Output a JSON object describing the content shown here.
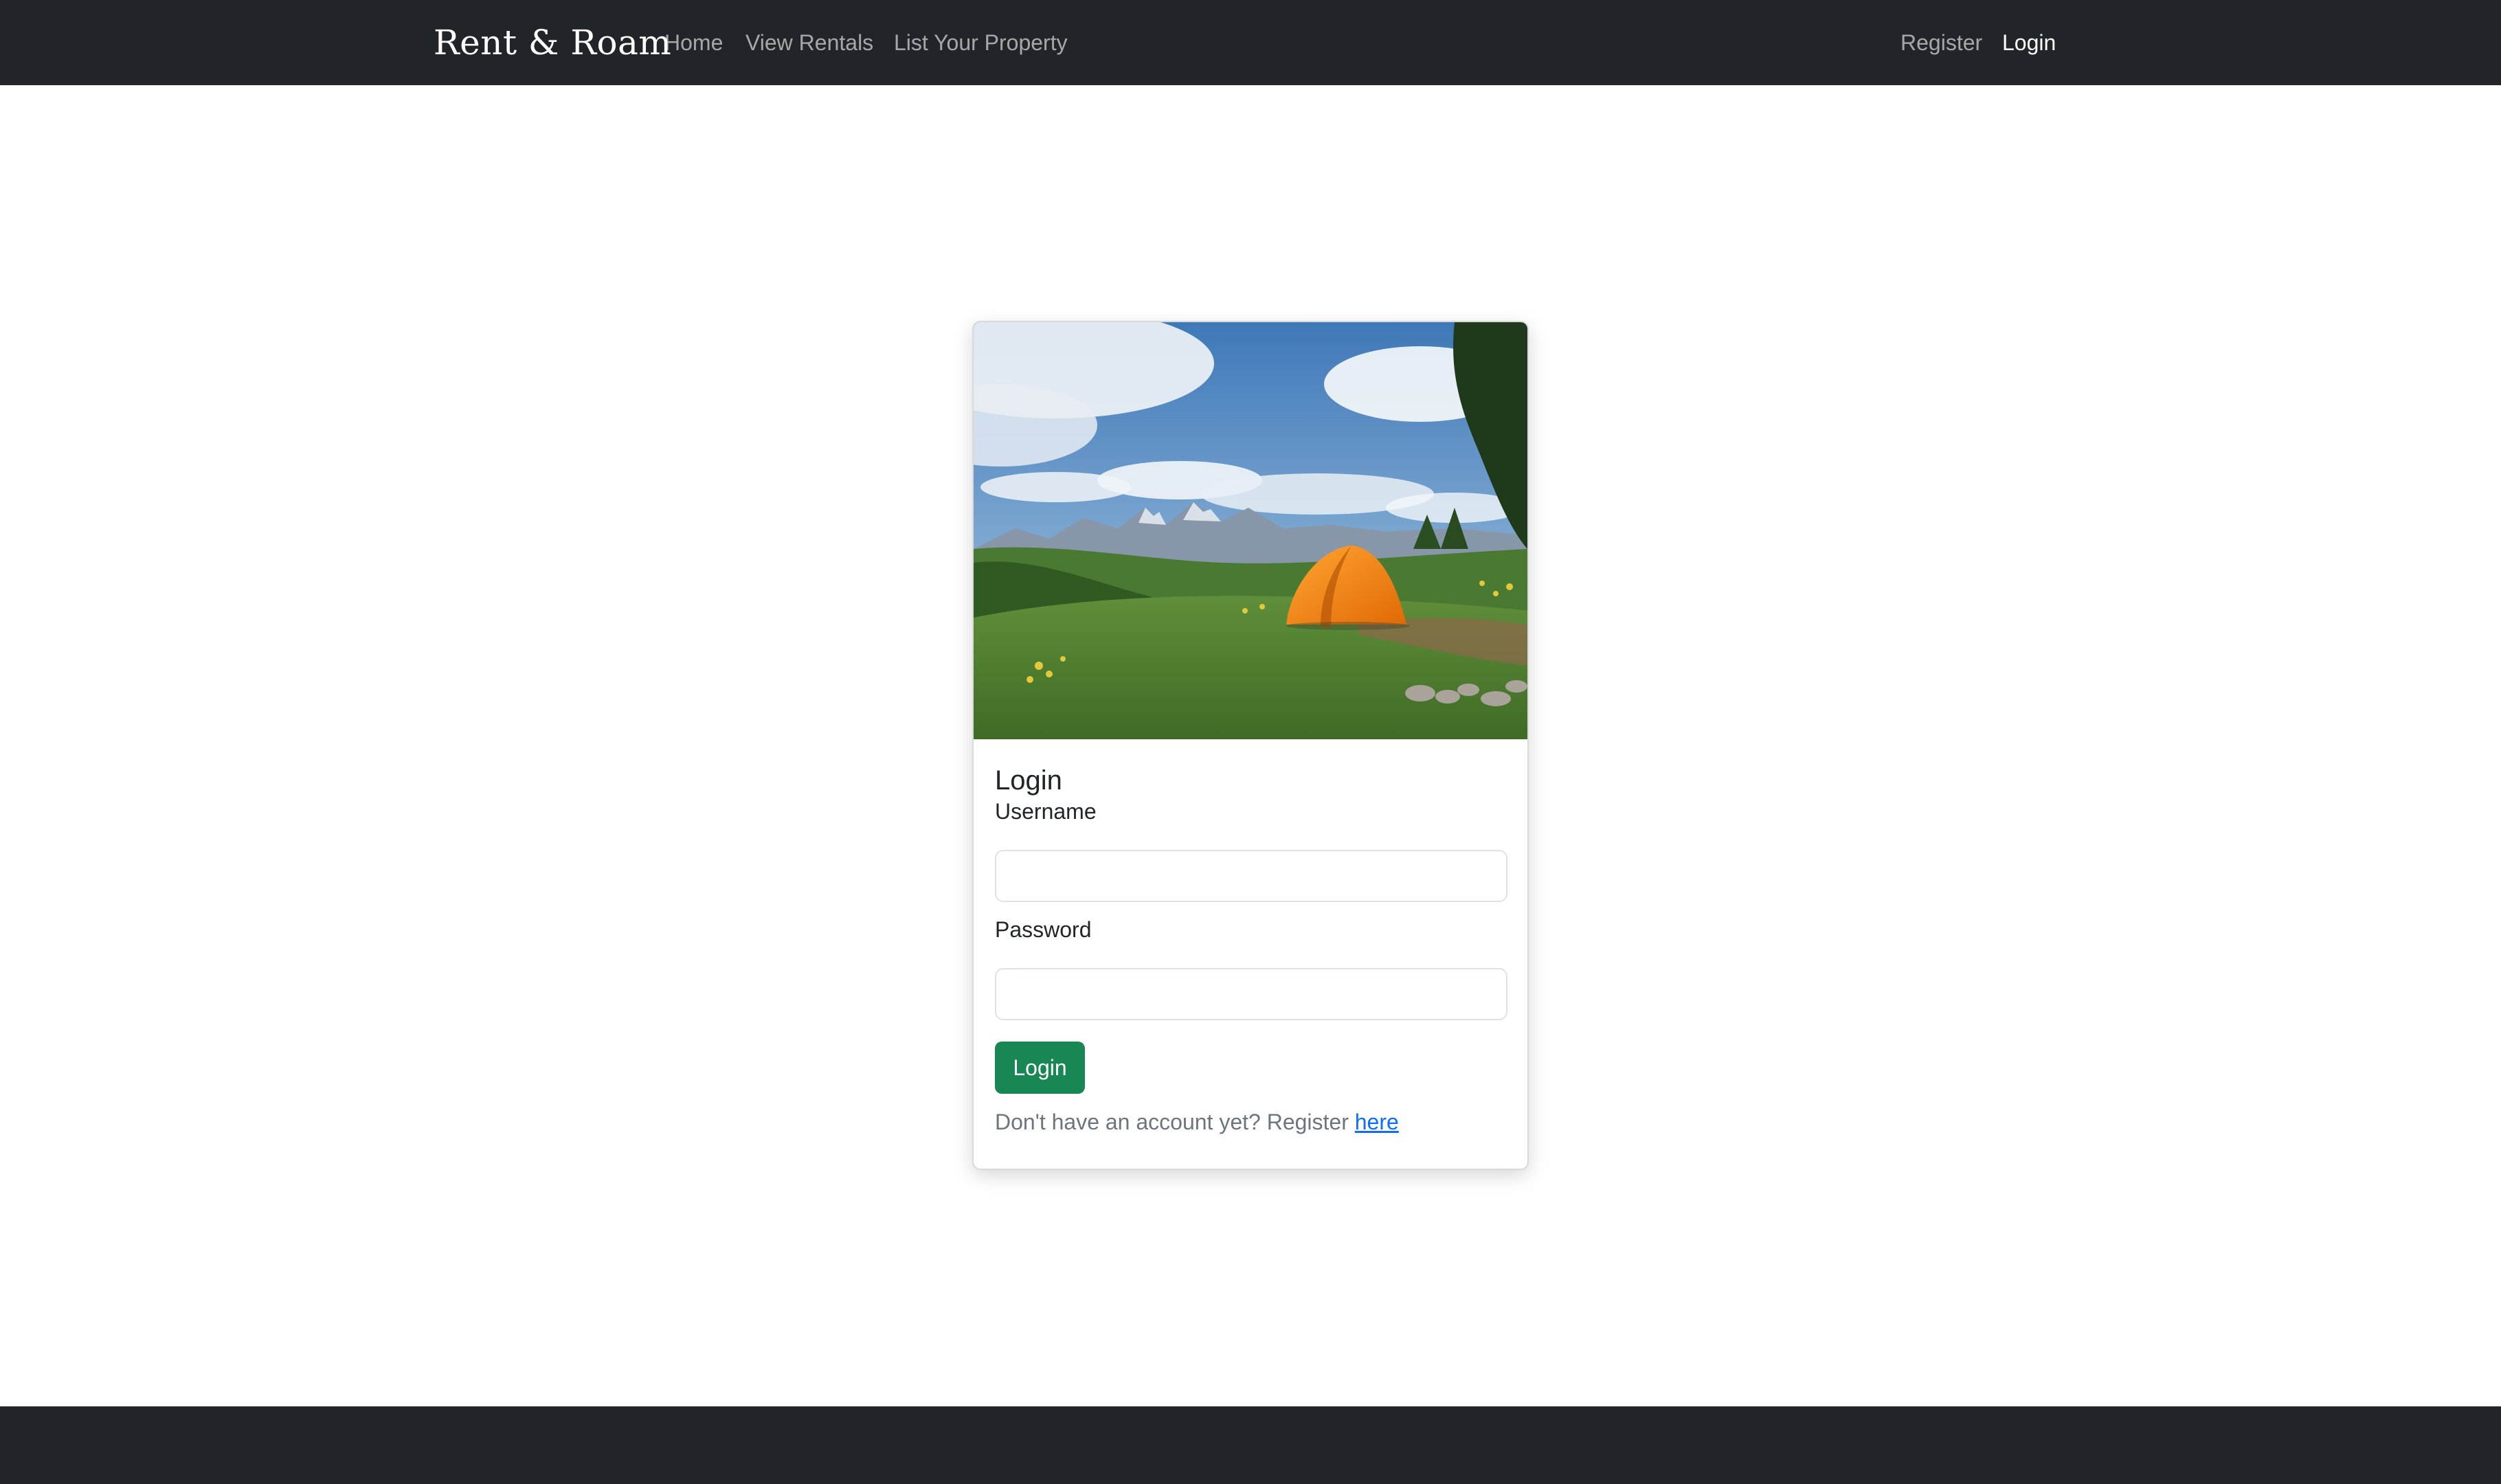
{
  "navbar": {
    "brand": "Rent & Roam",
    "links": [
      {
        "label": "Home"
      },
      {
        "label": "View Rentals"
      },
      {
        "label": "List Your Property"
      }
    ],
    "auth_links": [
      {
        "label": "Register",
        "active": false
      },
      {
        "label": "Login",
        "active": true
      }
    ],
    "background": "#212529"
  },
  "login_card": {
    "image": "tent-in-mountain-meadow",
    "title": "Login",
    "username_label": "Username",
    "username_value": "",
    "password_label": "Password",
    "password_value": "",
    "submit_label": "Login",
    "register_prompt": "Don't have an account yet? Register",
    "register_link": "here"
  },
  "colors": {
    "primary_button": "#198754",
    "link": "#0d6efd",
    "muted_text": "#6c757d",
    "footer": "#212529"
  }
}
